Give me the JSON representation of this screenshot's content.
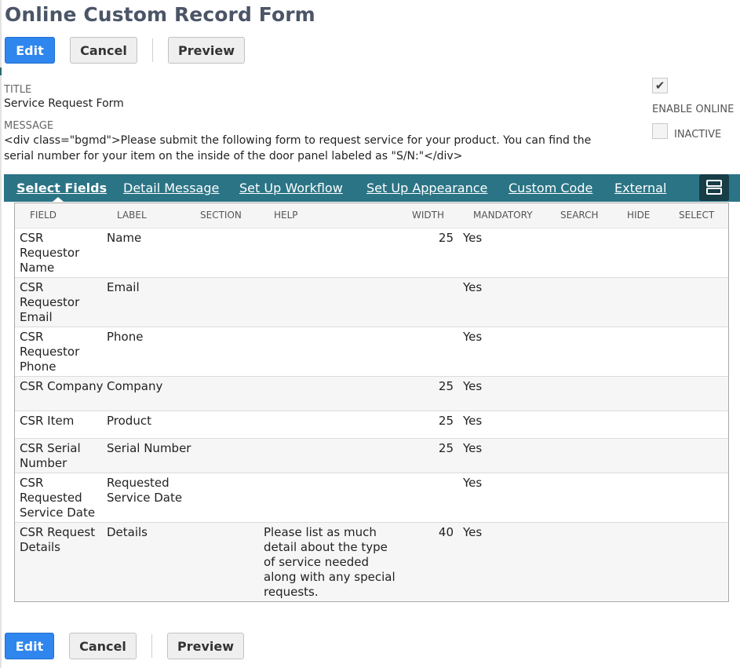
{
  "page": {
    "title": "Online Custom Record Form"
  },
  "toolbar": {
    "edit": "Edit",
    "cancel": "Cancel",
    "preview": "Preview"
  },
  "form": {
    "title_label": "TITLE",
    "title_value": "Service Request Form",
    "message_label": "MESSAGE",
    "message_value": "<div class=\"bgmd\">Please submit the following form to request service for your product.  You can find the serial number for your item on the inside of the door panel labeled as \"S/N:\"</div>",
    "enable_online_label": "ENABLE ONLINE",
    "enable_online_checked": true,
    "inactive_label": "INACTIVE",
    "inactive_checked": false,
    "check_glyph": "✔"
  },
  "tabs": [
    {
      "label": "Select Fields",
      "active": true
    },
    {
      "label": "Detail Message",
      "active": false
    },
    {
      "label": "Set Up Workflow",
      "active": false
    },
    {
      "label": "Set Up Appearance",
      "active": false
    },
    {
      "label": "Custom Code",
      "active": false
    },
    {
      "label": "External",
      "active": false
    }
  ],
  "menu_icon": "hamburger-layout-icon",
  "table": {
    "columns": [
      "FIELD",
      "LABEL",
      "SECTION",
      "HELP",
      "WIDTH",
      "MANDATORY",
      "SEARCH",
      "HIDE",
      "SELECT"
    ],
    "rows": [
      {
        "field": "CSR Requestor Name",
        "label": "Name",
        "section": "",
        "help": "",
        "width": "25",
        "mandatory": "Yes",
        "search": "",
        "hide": "",
        "select": ""
      },
      {
        "field": "CSR Requestor Email",
        "label": "Email",
        "section": "",
        "help": "",
        "width": "",
        "mandatory": "Yes",
        "search": "",
        "hide": "",
        "select": ""
      },
      {
        "field": "CSR Requestor Phone",
        "label": "Phone",
        "section": "",
        "help": "",
        "width": "",
        "mandatory": "Yes",
        "search": "",
        "hide": "",
        "select": ""
      },
      {
        "field": "CSR Company",
        "label": "Company",
        "section": "",
        "help": "",
        "width": "25",
        "mandatory": "Yes",
        "search": "",
        "hide": "",
        "select": ""
      },
      {
        "field": "CSR Item",
        "label": "Product",
        "section": "",
        "help": "",
        "width": "25",
        "mandatory": "Yes",
        "search": "",
        "hide": "",
        "select": ""
      },
      {
        "field": "CSR Serial Number",
        "label": "Serial Number",
        "section": "",
        "help": "",
        "width": "25",
        "mandatory": "Yes",
        "search": "",
        "hide": "",
        "select": ""
      },
      {
        "field": "CSR Requested Service Date",
        "label": "Requested Service Date",
        "section": "",
        "help": "",
        "width": "",
        "mandatory": "Yes",
        "search": "",
        "hide": "",
        "select": ""
      },
      {
        "field": "CSR Request Details",
        "label": "Details",
        "section": "",
        "help": "Please list as much detail about the type of service needed along with any special requests.",
        "width": "40",
        "mandatory": "Yes",
        "search": "",
        "hide": "",
        "select": ""
      }
    ]
  },
  "colors": {
    "primary": "#2f86ee",
    "tabbar": "#2a7485",
    "title": "#4b5567"
  }
}
